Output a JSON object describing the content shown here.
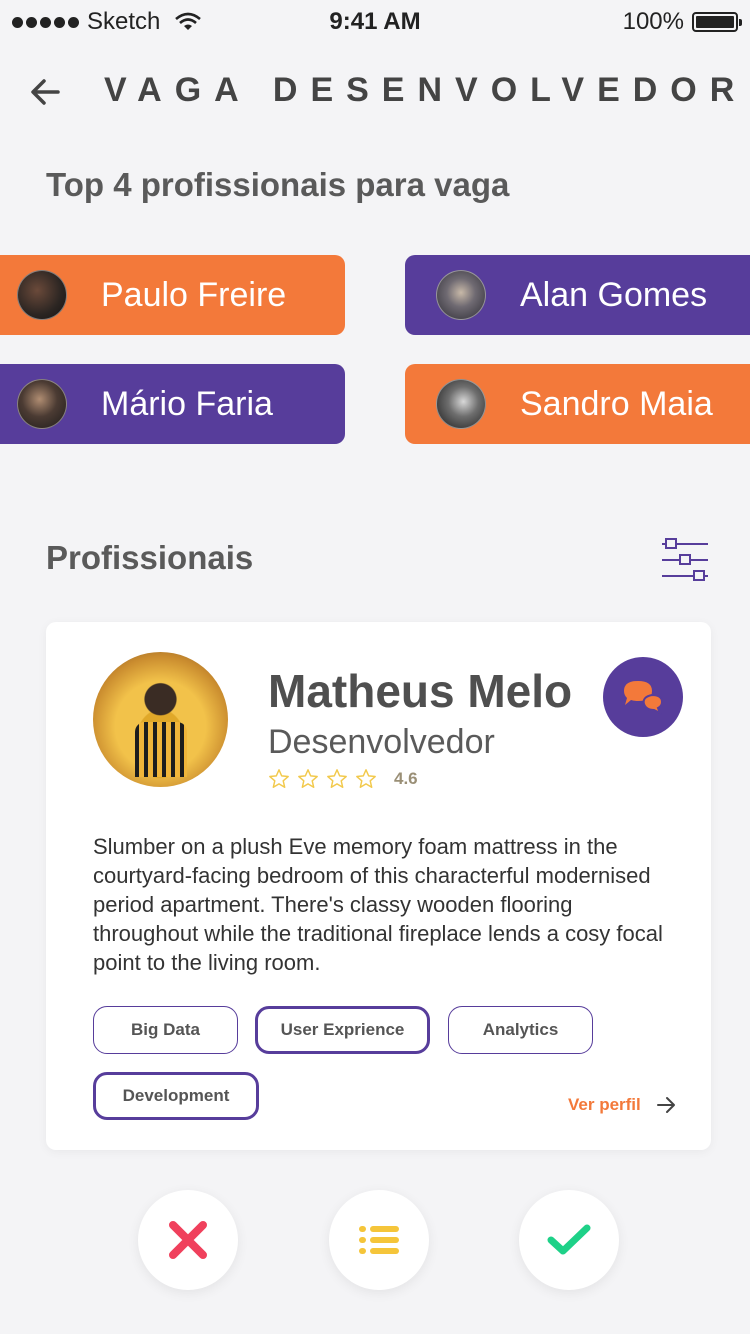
{
  "status_bar": {
    "carrier": "Sketch",
    "time": "9:41 AM",
    "battery": "100%"
  },
  "header": {
    "title": "VAGA DESENVOLVEDOR"
  },
  "top_section": {
    "title": "Top 4 profissionais para vaga",
    "professionals": [
      {
        "name": "Paulo Freire",
        "color": "#f3793a"
      },
      {
        "name": "Alan Gomes",
        "color": "#573d9b"
      },
      {
        "name": "Mário Faria",
        "color": "#573d9b"
      },
      {
        "name": "Sandro Maia",
        "color": "#f3793a"
      }
    ]
  },
  "professionals_section": {
    "title": "Profissionais"
  },
  "card": {
    "name": "Matheus Melo",
    "role": "Desenvolvedor",
    "rating": "4.6",
    "stars_filled": 0,
    "stars_total": 4,
    "description": "Slumber on a plush Eve memory foam mattress in the courtyard-facing bedroom of this characterful modernised period apartment. There's classy wooden flooring throughout while the traditional fireplace lends a cosy focal point to the living room.",
    "tags": [
      "Big Data",
      "User Exprience",
      "Analytics",
      "Development"
    ],
    "view_profile": "Ver perfil"
  },
  "colors": {
    "orange": "#f3793a",
    "purple": "#573d9b",
    "reject": "#f0405c",
    "list": "#f5c53a",
    "accept": "#1ed188"
  },
  "icons": {
    "back": "arrow-left-icon",
    "filter": "sliders-icon",
    "chat": "chat-bubbles-icon",
    "reject": "close-x-icon",
    "list": "list-icon",
    "accept": "check-icon"
  }
}
